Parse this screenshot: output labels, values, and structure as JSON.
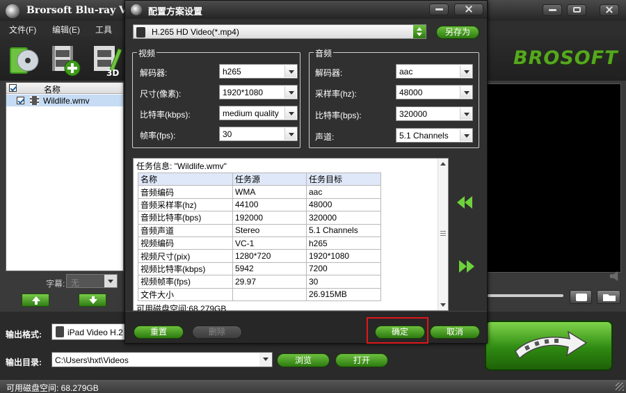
{
  "main_window": {
    "title": "Brorsoft Blu-ray Vid",
    "menu": [
      "文件(F)",
      "编辑(E)",
      "工具"
    ],
    "brand": "BROSOFT",
    "file_list": {
      "header_name": "名称",
      "items": [
        {
          "name": "Wildlife.wmv",
          "checked": true
        }
      ]
    },
    "subtitle": {
      "label": "字幕:",
      "value": "无"
    },
    "output_format": {
      "label": "输出格式:",
      "value": "iPad Video H.2"
    },
    "output_dir": {
      "label": "输出目录:",
      "value": "C:\\Users\\hxt\\Videos",
      "browse_label": "浏览",
      "open_label": "打开"
    },
    "status": "可用磁盘空间: 68.279GB",
    "icons": {
      "toolbar": [
        "disc-icon",
        "add-video-icon",
        "edit-3d-icon"
      ],
      "preview": [
        "volume-icon",
        "snapshot-icon",
        "folder-icon"
      ],
      "convert": "convert-arrow-icon"
    }
  },
  "dialog": {
    "title": "配置方案设置",
    "profile": {
      "value": "H.265 HD Video(*.mp4)",
      "save_as_label": "另存为"
    },
    "video": {
      "group_title": "视频",
      "codec": {
        "label": "解码器:",
        "value": "h265"
      },
      "size": {
        "label": "尺寸(像素):",
        "value": "1920*1080"
      },
      "bitrate": {
        "label": "比特率(kbps):",
        "value": "medium quality"
      },
      "framerate": {
        "label": "帧率(fps):",
        "value": "30"
      }
    },
    "audio": {
      "group_title": "音频",
      "codec": {
        "label": "解码器:",
        "value": "aac"
      },
      "samplerate": {
        "label": "采样率(hz):",
        "value": "48000"
      },
      "bitrate": {
        "label": "比特率(bps):",
        "value": "320000"
      },
      "channels": {
        "label": "声道:",
        "value": "5.1 Channels"
      }
    },
    "info": {
      "title": "任务信息: \"Wildlife.wmv\"",
      "columns": [
        "名称",
        "任务源",
        "任务目标"
      ],
      "rows": [
        [
          "音频编码",
          "WMA",
          "aac"
        ],
        [
          "音频采样率(hz)",
          "44100",
          "48000"
        ],
        [
          "音频比特率(bps)",
          "192000",
          "320000"
        ],
        [
          "音频声道",
          "Stereo",
          "5.1 Channels"
        ],
        [
          "视频编码",
          "VC-1",
          "h265"
        ],
        [
          "视频尺寸(pix)",
          "1280*720",
          "1920*1080"
        ],
        [
          "视频比特率(kbps)",
          "5942",
          "7200"
        ],
        [
          "视频帧率(fps)",
          "29.97",
          "30"
        ],
        [
          "文件大小",
          "",
          "26.915MB"
        ]
      ],
      "free_space": "可用磁盘空间:68.279GB"
    },
    "buttons": {
      "reset": "重置",
      "delete": "删除",
      "ok": "确定",
      "cancel": "取消"
    },
    "highlight_color": "#e0161a"
  },
  "colors": {
    "accent_green": "#2c7a10",
    "highlight_red": "#e0161a",
    "selection_blue": "#c6dcf4"
  }
}
